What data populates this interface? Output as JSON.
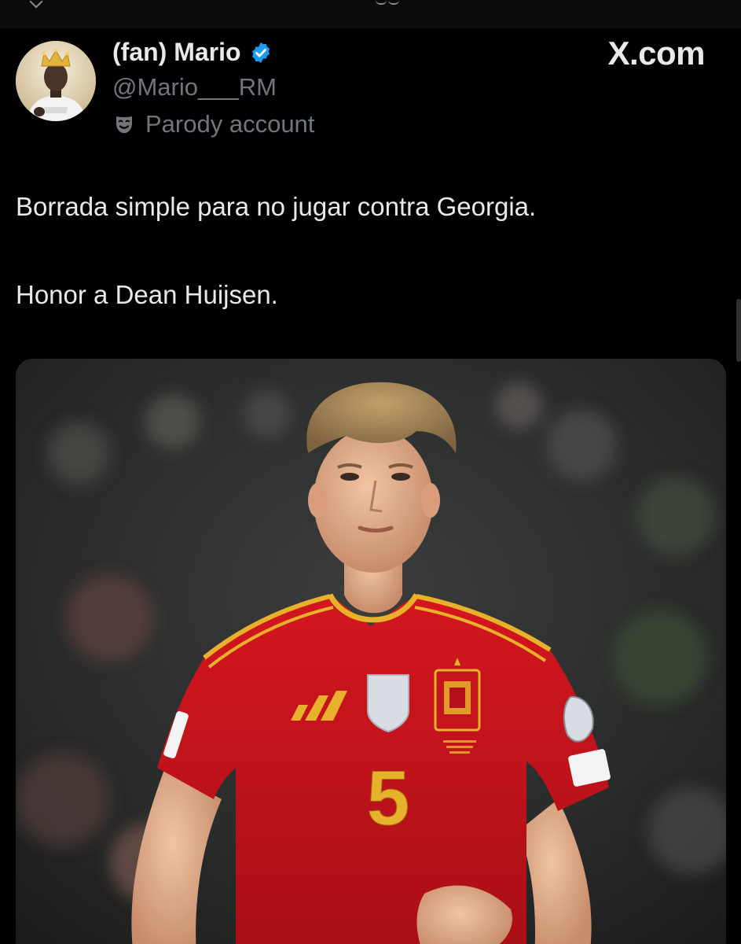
{
  "post": {
    "display_name": "(fan) Mario",
    "handle": "@Mario___RM",
    "label": "Parody account",
    "verified": true,
    "brand": "X.com",
    "text_lines": [
      "Borrada simple para no jugar contra Georgia.",
      "Honor a Dean Huijsen."
    ]
  },
  "media": {
    "jersey_number": "5",
    "jersey_color": "#c8141c",
    "trim_color": "#e8b12c"
  },
  "icons": {
    "verified": "verified-badge-icon",
    "parody": "theater-mask-icon"
  },
  "colors": {
    "background": "#000000",
    "text": "#e7e9ea",
    "muted": "#71767b",
    "verified": "#1d9bf0"
  }
}
